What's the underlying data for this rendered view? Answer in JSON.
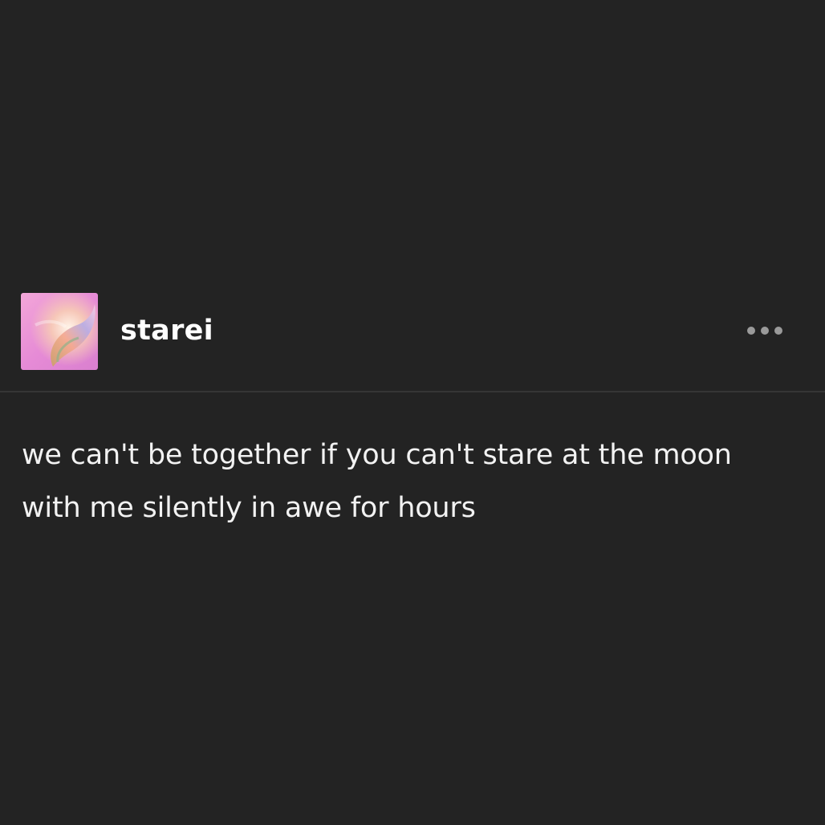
{
  "post": {
    "author": {
      "username": "starei",
      "avatar_icon": "gradient-avatar-icon"
    },
    "menu": {
      "icon": "more-dots-icon"
    },
    "body": {
      "text": "we can't be together if you can't stare at the moon with me silently in awe for hours"
    }
  },
  "colors": {
    "background": "#232323",
    "text": "#ffffff",
    "divider": "#353535",
    "menu_dots": "#9a9a9a"
  }
}
